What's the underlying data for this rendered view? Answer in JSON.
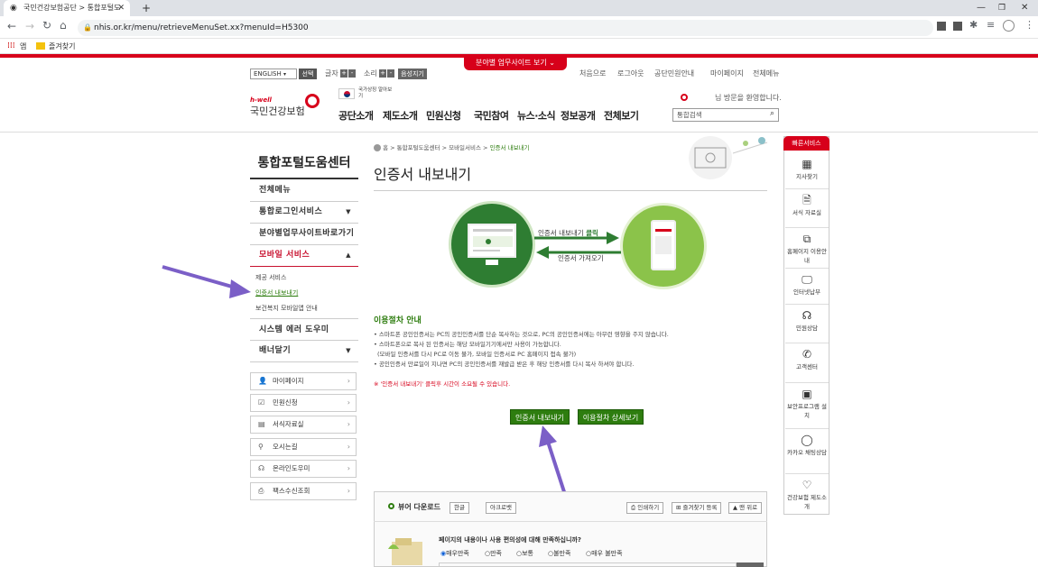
{
  "browser": {
    "tab_title": "국민건강보험공단 > 통합포털도",
    "new_tab": "+",
    "url": "nhis.or.kr/menu/retrieveMenuSet.xx?menuId=H5300",
    "bookmarks": [
      {
        "label": "앱"
      },
      {
        "label": "즐겨찾기"
      }
    ]
  },
  "utility": {
    "language": "ENGLISH",
    "select": "선택",
    "text_label": "글자",
    "sound_label": "소리",
    "voice": "음성지기",
    "business_site": "분야별 업무사이트 보기",
    "links": [
      "처음으로",
      "로그아웃",
      "공단민원안내",
      "마이페이지",
      "전체메뉴"
    ]
  },
  "header": {
    "logo_sub": "h-well",
    "logo_main": "국민건강보험",
    "national": "국가상징 알아보기",
    "welcome": "님 방문을 환영합니다.",
    "search_placeholder": "통합검색",
    "gnb": [
      "공단소개",
      "제도소개",
      "민원신청",
      "국민참여",
      "뉴스·소식",
      "정보공개",
      "전체보기"
    ]
  },
  "sidebar": {
    "title": "통합포털도움센터",
    "items": [
      {
        "label": "전체메뉴"
      },
      {
        "label": "통합로그인서비스"
      },
      {
        "label": "분야별업무사이트바로가기"
      },
      {
        "label": "모바일 서비스"
      },
      {
        "label": "시스템 에러 도우미"
      },
      {
        "label": "배너달기"
      }
    ],
    "sub_items": [
      "제공 서비스",
      "인증서 내보내기",
      "보건복지 모바일앱 안내"
    ],
    "quick": [
      "마이페이지",
      "민원신청",
      "서식자료실",
      "오시는길",
      "온라인도우미",
      "팩스수신조회"
    ]
  },
  "main": {
    "breadcrumb": [
      "홈",
      "통합포털도움센터",
      "모바일서비스",
      "인증서 내보내기"
    ],
    "title": "인증서 내보내기",
    "diagram_export": "인증서 내보내기",
    "diagram_click": "클릭",
    "diagram_import": "인증서 가져오기",
    "section_title": "이용절차 안내",
    "notes": [
      "스마트폰 공인인증서는 PC의 공인인증서를 단순 복사하는 것으로, PC의 공인인증서에는 아무런 영향을 주지 않습니다.",
      "스마트폰으로 복사 된 인증서는 해당 모바일기기에서만 사용이 가능합니다.",
      "(모바일 인증서를 다시 PC로 이동 불가, 모바일 인증서로 PC 홈페이지 접속 불가)",
      "공인인증서 만료일이 지나면 PC의 공인인증서를 재발급 받은 후 해당 인증서를 다시 복사 하셔야 합니다."
    ],
    "warning": "※ '인증서 내보내기' 클릭후 시간이 소요될 수 있습니다.",
    "btn_export": "인증서 내보내기",
    "btn_detail": "이용절차 상세보기",
    "viewer": "뷰어 다운로드",
    "viewer_hangul": "한글",
    "viewer_acrobat": "아크로뱃",
    "print": "인쇄하기",
    "favorite": "즐겨찾기 등록",
    "top": "맨 위로",
    "survey_q": "페이지의 내용이나 사용 편의성에 대해 만족하십니까?",
    "survey_options": [
      "매우만족",
      "만족",
      "보통",
      "불만족",
      "매우 불만족"
    ]
  },
  "quick_right": {
    "title": "빠른서비스",
    "items": [
      "지사찾기",
      "서식 자료실",
      "홈페이지 이용안내",
      "인터넷납부",
      "민원상담",
      "고객센터",
      "보안프로그램 설치",
      "카카오 채팅상담",
      "건강보험 제도소개"
    ]
  }
}
